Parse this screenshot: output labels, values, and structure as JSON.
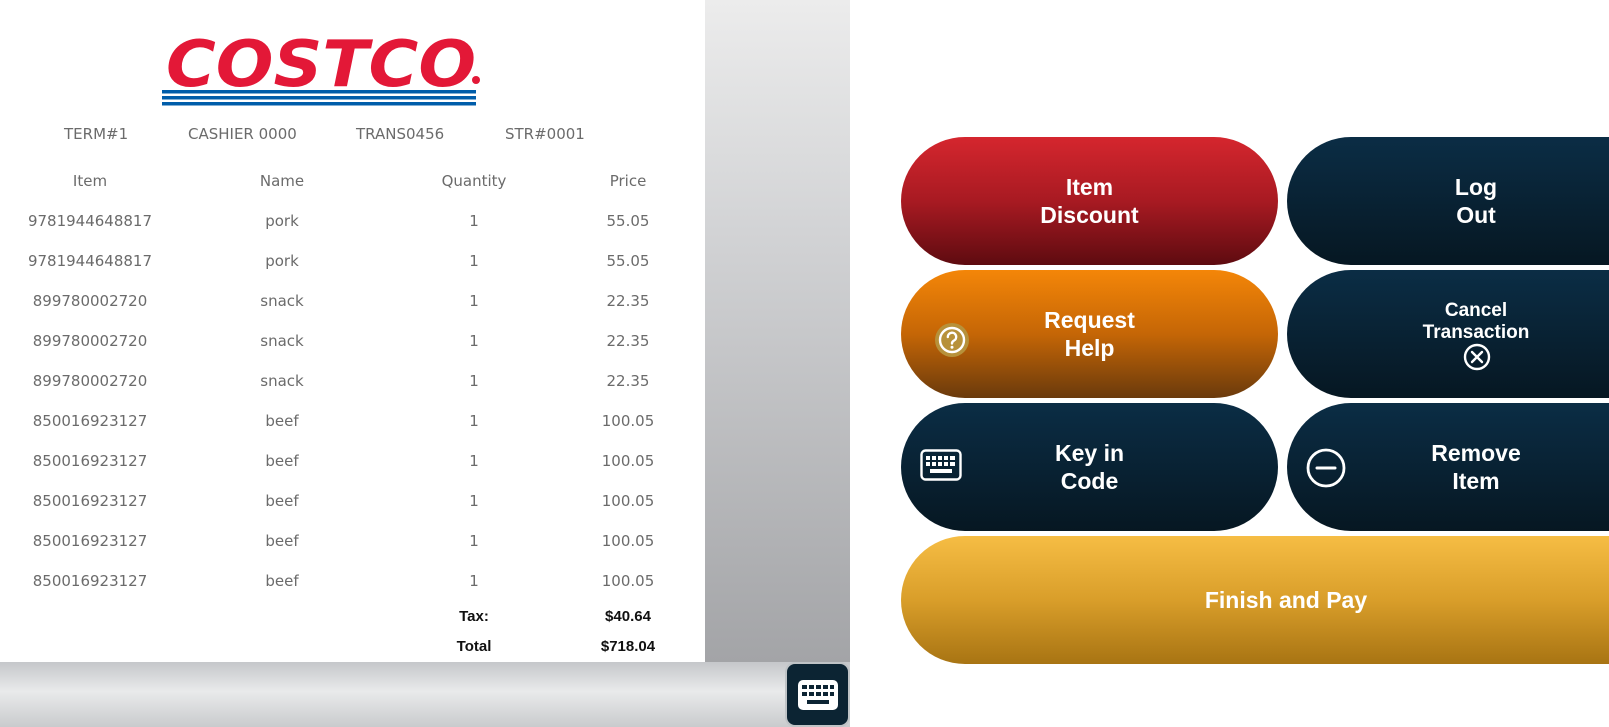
{
  "logo": {
    "text": "COSTCO",
    "brand_color": "#e31837",
    "stripe_color": "#005daa"
  },
  "meta": {
    "terminal": "TERM#1",
    "cashier": "CASHIER 0000",
    "transaction": "TRANS0456",
    "store": "STR#0001"
  },
  "columns": {
    "item": "Item",
    "name": "Name",
    "quantity": "Quantity",
    "price": "Price"
  },
  "items": [
    {
      "item": "9781944648817",
      "name": "pork",
      "quantity": "1",
      "price": "55.05"
    },
    {
      "item": "9781944648817",
      "name": "pork",
      "quantity": "1",
      "price": "55.05"
    },
    {
      "item": "899780002720",
      "name": "snack",
      "quantity": "1",
      "price": "22.35"
    },
    {
      "item": "899780002720",
      "name": "snack",
      "quantity": "1",
      "price": "22.35"
    },
    {
      "item": "899780002720",
      "name": "snack",
      "quantity": "1",
      "price": "22.35"
    },
    {
      "item": "850016923127",
      "name": "beef",
      "quantity": "1",
      "price": "100.05"
    },
    {
      "item": "850016923127",
      "name": "beef",
      "quantity": "1",
      "price": "100.05"
    },
    {
      "item": "850016923127",
      "name": "beef",
      "quantity": "1",
      "price": "100.05"
    },
    {
      "item": "850016923127",
      "name": "beef",
      "quantity": "1",
      "price": "100.05"
    },
    {
      "item": "850016923127",
      "name": "beef",
      "quantity": "1",
      "price": "100.05"
    }
  ],
  "totals": {
    "tax_label": "Tax:",
    "tax_value": "$40.64",
    "total_label": "Total",
    "total_value": "$718.04"
  },
  "buttons": {
    "item_discount": {
      "line1": "Item",
      "line2": "Discount"
    },
    "log_out": {
      "line1": "Log",
      "line2": "Out"
    },
    "request_help": {
      "line1": "Request",
      "line2": "Help",
      "icon": "question-circle-icon"
    },
    "cancel_transaction": {
      "line1": "Cancel",
      "line2": "Transaction",
      "icon": "x-circle-icon"
    },
    "key_in_code": {
      "line1": "Key in",
      "line2": "Code",
      "icon": "keyboard-icon"
    },
    "remove_item": {
      "line1": "Remove",
      "line2": "Item",
      "icon": "minus-circle-icon"
    },
    "finish_and_pay": {
      "label": "Finish and Pay"
    }
  },
  "keyboard_toggle": {
    "icon": "keyboard-icon"
  },
  "colors": {
    "dark_button": "#0b2d45",
    "red_button": "#d5262e",
    "orange_button": "#f48608",
    "gold_button": "#f6bd44"
  }
}
